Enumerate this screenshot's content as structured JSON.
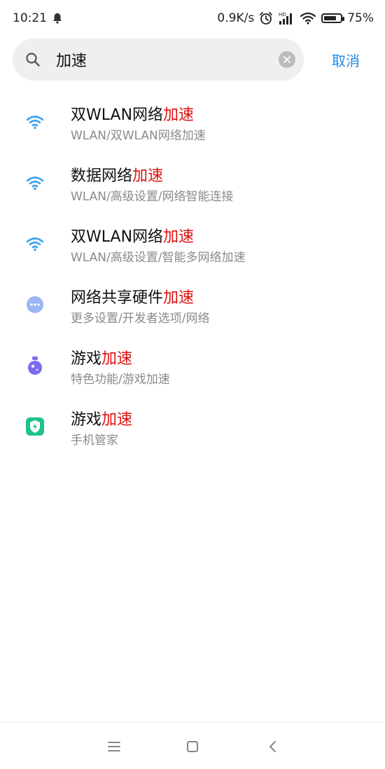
{
  "status_bar": {
    "time": "10:21",
    "net_speed": "0.9K/s",
    "battery_percent": "75%",
    "battery_level": 0.75,
    "icons": [
      "notification-bell-icon",
      "alarm-icon",
      "hd-signal-icon",
      "wifi-icon",
      "battery-icon"
    ]
  },
  "search": {
    "query": "加速",
    "cancel_label": "取消"
  },
  "results": [
    {
      "icon": "wifi-icon",
      "title_pre": "双WLAN网络",
      "title_hl": "加速",
      "path": "WLAN/双WLAN网络加速"
    },
    {
      "icon": "wifi-icon",
      "title_pre": "数据网络",
      "title_hl": "加速",
      "path": "WLAN/高级设置/网络智能连接"
    },
    {
      "icon": "wifi-icon",
      "title_pre": "双WLAN网络",
      "title_hl": "加速",
      "path": "WLAN/高级设置/智能多网络加速"
    },
    {
      "icon": "more-dots-icon",
      "title_pre": "网络共享硬件",
      "title_hl": "加速",
      "path": "更多设置/开发者选项/网络"
    },
    {
      "icon": "game-turbo-icon",
      "title_pre": "游戏",
      "title_hl": "加速",
      "path": "特色功能/游戏加速"
    },
    {
      "icon": "security-shield-icon",
      "title_pre": "游戏",
      "title_hl": "加速",
      "path": "手机管家"
    }
  ],
  "colors": {
    "highlight": "#e01010",
    "accent": "#1d8be8",
    "wifi_icon": "#3aa3f0",
    "dots_icon": "#9bb6f2",
    "game_icon": "#7b6cf0",
    "security_icon": "#1fc28f"
  },
  "nav_bar": {
    "icons": [
      "menu-icon",
      "home-icon",
      "back-icon"
    ]
  }
}
